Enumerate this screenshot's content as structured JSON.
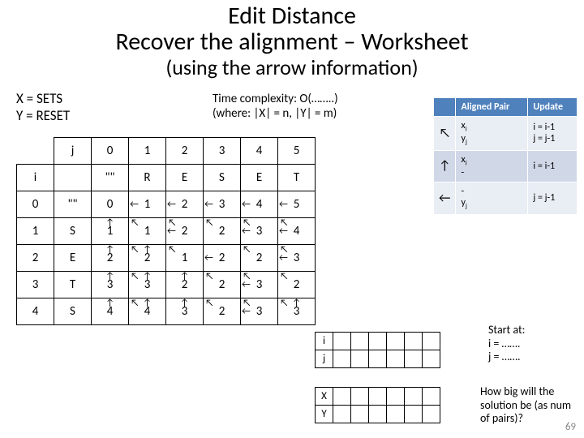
{
  "title_line1": "Edit Distance",
  "title_line2": "Recover the alignment – Worksheet",
  "subtitle": "(using the arrow information)",
  "defs": {
    "x": "X = SETS",
    "y": "Y = RESET"
  },
  "complexity": {
    "line1": "Time complexity:  O(……..)",
    "line2": "(where: |X| = n, |Y| = m)"
  },
  "legend": {
    "hdr_pair": "Aligned Pair",
    "hdr_update": "Update",
    "rows": [
      {
        "arrow": "↖",
        "pair_a": "x",
        "pair_a_sub": "i",
        "pair_b": "y",
        "pair_b_sub": "j",
        "update_a": "i = i-1",
        "update_b": "j = j-1"
      },
      {
        "arrow": "↑",
        "pair_a": "x",
        "pair_a_sub": "i",
        "pair_b": "-",
        "pair_b_sub": "",
        "update_a": "i = i-1",
        "update_b": ""
      },
      {
        "arrow": "←",
        "pair_a": "-",
        "pair_a_sub": "",
        "pair_b": "y",
        "pair_b_sub": "j",
        "update_a": "j = j-1",
        "update_b": ""
      }
    ]
  },
  "dp": {
    "j_label": "j",
    "i_label": "i",
    "col_idx": [
      "0",
      "1",
      "2",
      "3",
      "4",
      "5"
    ],
    "row_idx": [
      "0",
      "1",
      "2",
      "3",
      "4"
    ],
    "col_chars": [
      "\"\"",
      "R",
      "E",
      "S",
      "E",
      "T"
    ],
    "row_chars": [
      "\"\"",
      "S",
      "E",
      "T",
      "S"
    ],
    "cells": [
      [
        {
          "v": "0",
          "a": []
        },
        {
          "v": "1",
          "a": [
            "l"
          ]
        },
        {
          "v": "2",
          "a": [
            "l"
          ]
        },
        {
          "v": "3",
          "a": [
            "l"
          ]
        },
        {
          "v": "4",
          "a": [
            "l"
          ]
        },
        {
          "v": "5",
          "a": [
            "l"
          ]
        }
      ],
      [
        {
          "v": "1",
          "a": [
            "u"
          ]
        },
        {
          "v": "1",
          "a": [
            "d"
          ]
        },
        {
          "v": "2",
          "a": [
            "d",
            "l"
          ]
        },
        {
          "v": "2",
          "a": [
            "d"
          ]
        },
        {
          "v": "3",
          "a": [
            "d",
            "l"
          ]
        },
        {
          "v": "4",
          "a": [
            "d",
            "l"
          ]
        }
      ],
      [
        {
          "v": "2",
          "a": [
            "u"
          ]
        },
        {
          "v": "2",
          "a": [
            "d",
            "u"
          ]
        },
        {
          "v": "1",
          "a": [
            "d"
          ]
        },
        {
          "v": "2",
          "a": [
            "l"
          ]
        },
        {
          "v": "2",
          "a": [
            "d"
          ]
        },
        {
          "v": "3",
          "a": [
            "d",
            "l"
          ]
        }
      ],
      [
        {
          "v": "3",
          "a": [
            "u"
          ]
        },
        {
          "v": "3",
          "a": [
            "d",
            "u"
          ]
        },
        {
          "v": "2",
          "a": [
            "u"
          ]
        },
        {
          "v": "2",
          "a": [
            "d"
          ]
        },
        {
          "v": "3",
          "a": [
            "d",
            "l"
          ]
        },
        {
          "v": "2",
          "a": [
            "d"
          ]
        }
      ],
      [
        {
          "v": "4",
          "a": [
            "u"
          ]
        },
        {
          "v": "4",
          "a": [
            "d",
            "u"
          ]
        },
        {
          "v": "3",
          "a": [
            "u"
          ]
        },
        {
          "v": "2",
          "a": [
            "d"
          ]
        },
        {
          "v": "3",
          "a": [
            "d",
            "l"
          ]
        },
        {
          "v": "3",
          "a": [
            "d",
            "u"
          ]
        }
      ]
    ]
  },
  "ij": {
    "labels": [
      "i",
      "j"
    ]
  },
  "xy": {
    "labels": [
      "X",
      "Y"
    ]
  },
  "note1": "Start at:\ni = …….\nj = …….",
  "note2": "How big will the solution be (as num of pairs)?",
  "pagenum": "69"
}
